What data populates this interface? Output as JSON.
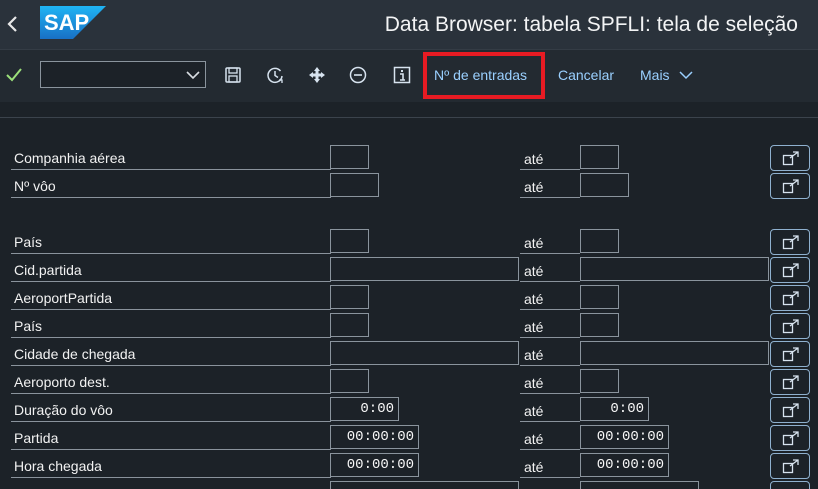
{
  "app": {
    "title": "Data Browser: tabela SPFLI: tela de seleção",
    "logo_text": "SAP"
  },
  "toolbar": {
    "variant_value": "",
    "entries_label": "Nº de entradas",
    "cancel_label": "Cancelar",
    "more_label": "Mais"
  },
  "range_label": "até",
  "fields": [
    {
      "label": "Companhia aérea",
      "from": "",
      "to": ""
    },
    {
      "label": "Nº vôo",
      "from": "",
      "to": ""
    },
    {
      "label": "País",
      "from": "",
      "to": ""
    },
    {
      "label": "Cid.partida",
      "from": "",
      "to": ""
    },
    {
      "label": "AeroportPartida",
      "from": "",
      "to": ""
    },
    {
      "label": "País",
      "from": "",
      "to": ""
    },
    {
      "label": "Cidade de chegada",
      "from": "",
      "to": ""
    },
    {
      "label": "Aeroporto dest.",
      "from": "",
      "to": ""
    },
    {
      "label": "Duração do vôo",
      "from": "0:00",
      "to": "0:00"
    },
    {
      "label": "Partida",
      "from": "00:00:00",
      "to": "00:00:00"
    },
    {
      "label": "Hora chegada",
      "from": "00:00:00",
      "to": "00:00:00"
    }
  ],
  "colors": {
    "accent": "#9ad0ff",
    "highlight": "#e81b23",
    "background": "#1c2228",
    "header": "#2a323b"
  }
}
